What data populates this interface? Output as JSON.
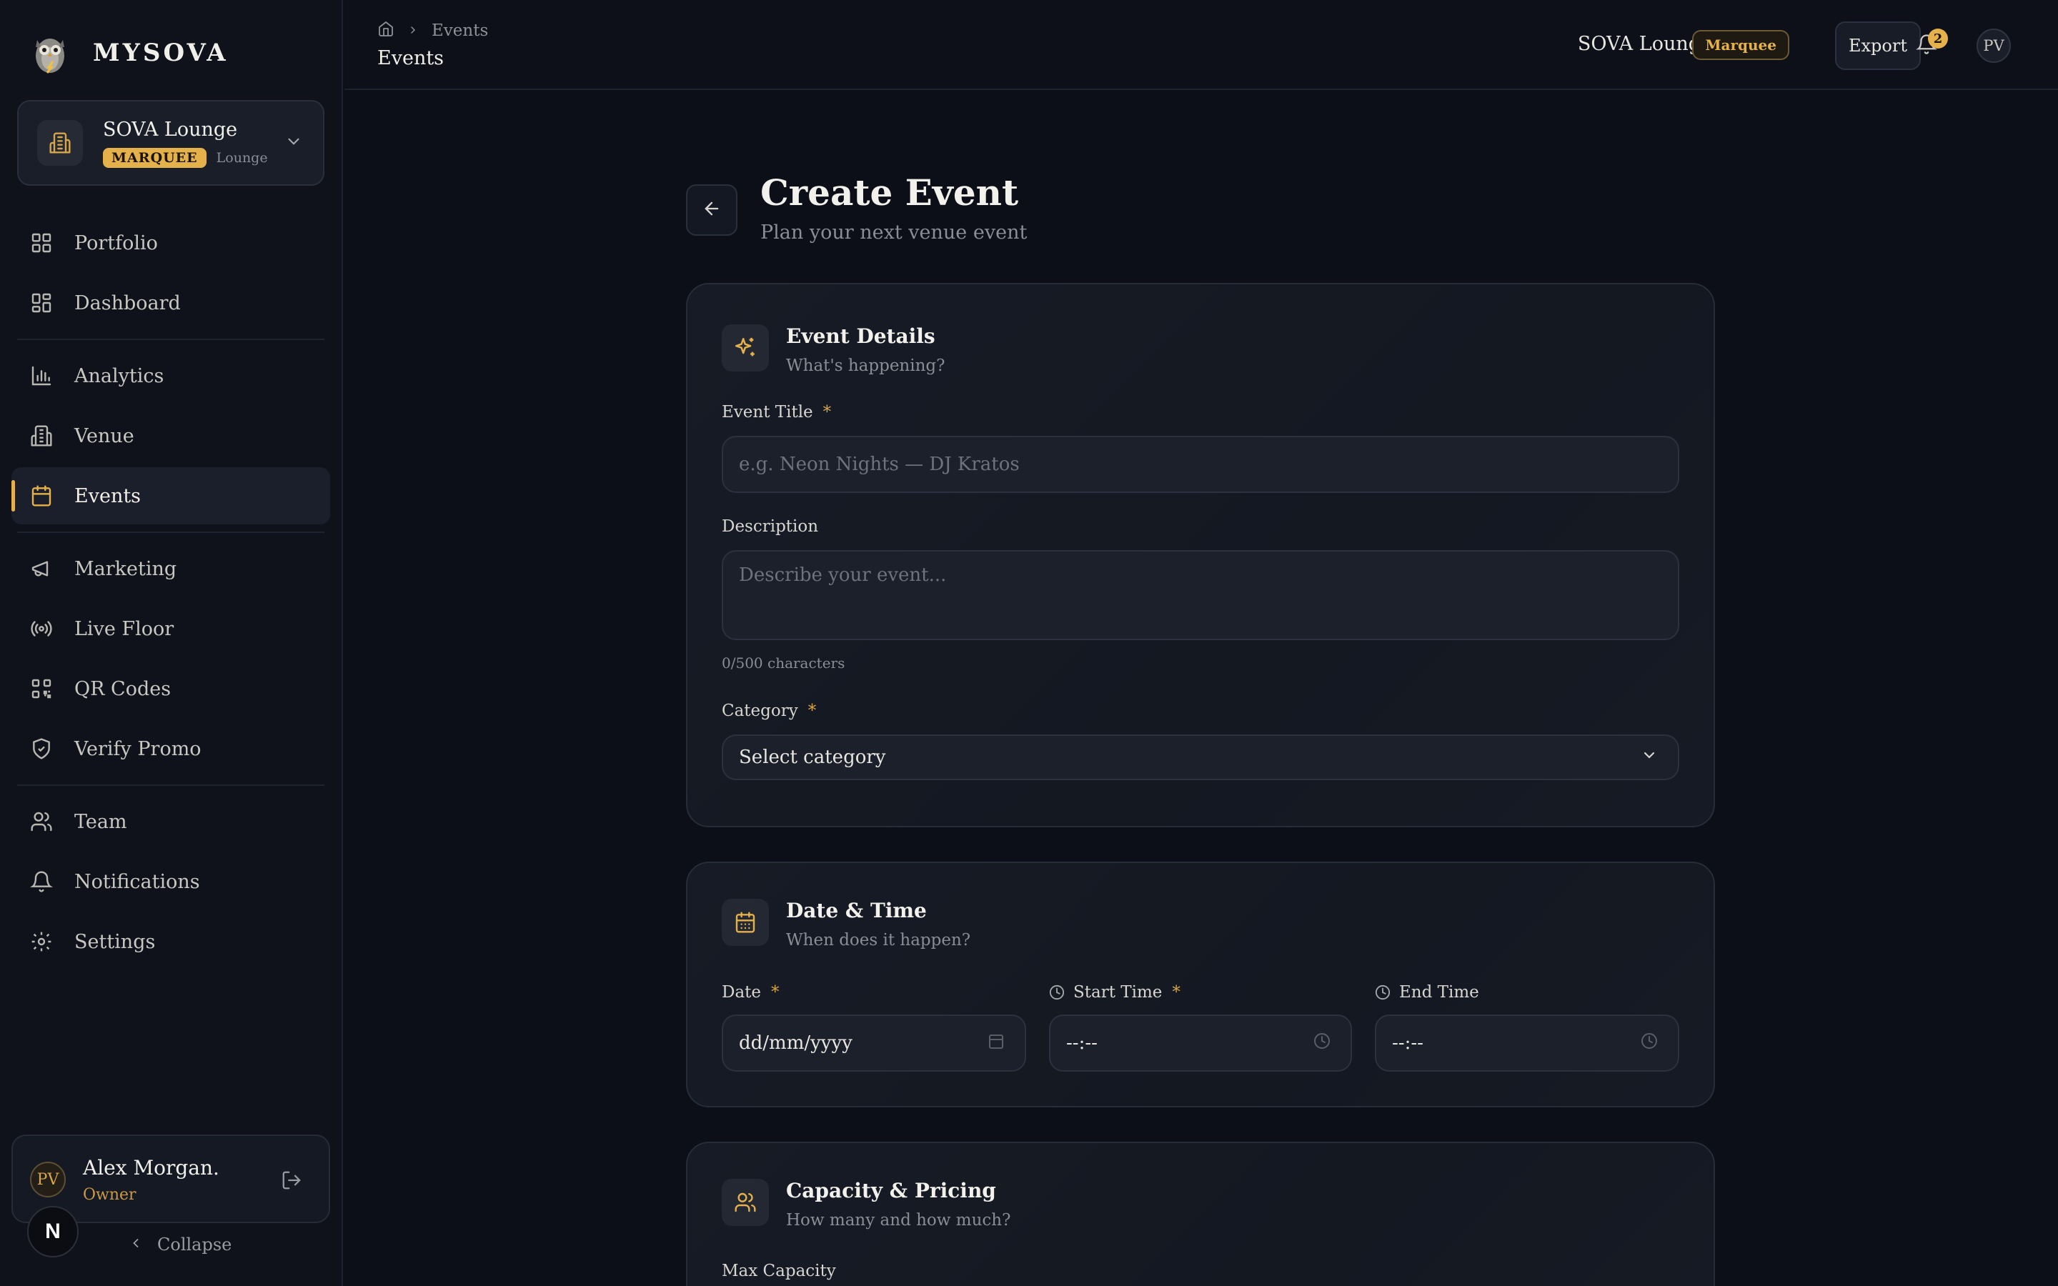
{
  "brand": {
    "name": "MYSOVA"
  },
  "venue_switcher": {
    "name": "SOVA Lounge",
    "tier": "MARQUEE",
    "type": "Lounge"
  },
  "nav": {
    "items": [
      {
        "key": "portfolio",
        "label": "Portfolio",
        "icon": "grid-icon"
      },
      {
        "key": "dashboard",
        "label": "Dashboard",
        "icon": "dashboard-icon"
      },
      {
        "key": "analytics",
        "label": "Analytics",
        "icon": "bar-chart-icon"
      },
      {
        "key": "venue",
        "label": "Venue",
        "icon": "building-icon"
      },
      {
        "key": "events",
        "label": "Events",
        "icon": "calendar-icon",
        "active": true
      },
      {
        "key": "marketing",
        "label": "Marketing",
        "icon": "megaphone-icon"
      },
      {
        "key": "live-floor",
        "label": "Live Floor",
        "icon": "broadcast-icon"
      },
      {
        "key": "qr-codes",
        "label": "QR Codes",
        "icon": "qr-code-icon"
      },
      {
        "key": "verify-promo",
        "label": "Verify Promo",
        "icon": "shield-check-icon"
      },
      {
        "key": "team",
        "label": "Team",
        "icon": "users-icon"
      },
      {
        "key": "notifications",
        "label": "Notifications",
        "icon": "bell-icon"
      },
      {
        "key": "settings",
        "label": "Settings",
        "icon": "gear-icon"
      }
    ]
  },
  "user": {
    "initials": "PV",
    "name": "Alex Morgan.",
    "role": "Owner"
  },
  "collapse_label": "Collapse",
  "n_badge": "N",
  "topbar": {
    "breadcrumb": "Events",
    "page_name": "Events",
    "venue_name": "SOVA Lounge",
    "tier": "Marquee",
    "export_label": "Export",
    "notification_count": "2",
    "avatar_initials": "PV"
  },
  "page": {
    "title": "Create Event",
    "subtitle": "Plan your next venue event"
  },
  "event_details": {
    "title": "Event Details",
    "subtitle": "What's happening?",
    "event_title_label": "Event Title",
    "event_title_placeholder": "e.g. Neon Nights — DJ Kratos",
    "description_label": "Description",
    "description_placeholder": "Describe your event...",
    "char_count": "0/500 characters",
    "category_label": "Category",
    "category_value": "Select category"
  },
  "date_time": {
    "title": "Date & Time",
    "subtitle": "When does it happen?",
    "date_label": "Date",
    "date_value": "dd/mm/yyyy",
    "start_label": "Start Time",
    "start_value": "--:--",
    "end_label": "End Time",
    "end_value": "--:--"
  },
  "capacity": {
    "title": "Capacity & Pricing",
    "subtitle": "How many and how much?",
    "max_capacity_label": "Max Capacity"
  },
  "required_marker": "*",
  "colors": {
    "accent": "#e5b14a",
    "background": "#0c0f17",
    "card": "#161a24"
  }
}
